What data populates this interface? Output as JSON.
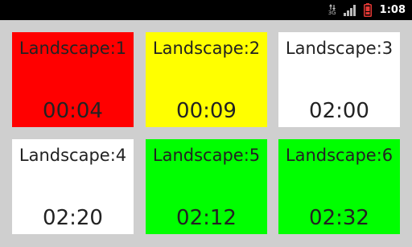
{
  "status_bar": {
    "network_type": "3G",
    "signal_icon": "signal-bars-icon",
    "battery_icon": "battery-low-icon",
    "battery_color": "#e53935",
    "time": "1:08"
  },
  "tiles": [
    {
      "label": "Landscape:1",
      "time": "00:04",
      "color": "#ff0000"
    },
    {
      "label": "Landscape:2",
      "time": "00:09",
      "color": "#ffff00"
    },
    {
      "label": "Landscape:3",
      "time": "02:00",
      "color": "#ffffff"
    },
    {
      "label": "Landscape:4",
      "time": "02:20",
      "color": "#ffffff"
    },
    {
      "label": "Landscape:5",
      "time": "02:12",
      "color": "#00ff00"
    },
    {
      "label": "Landscape:6",
      "time": "02:32",
      "color": "#00ff00"
    }
  ]
}
